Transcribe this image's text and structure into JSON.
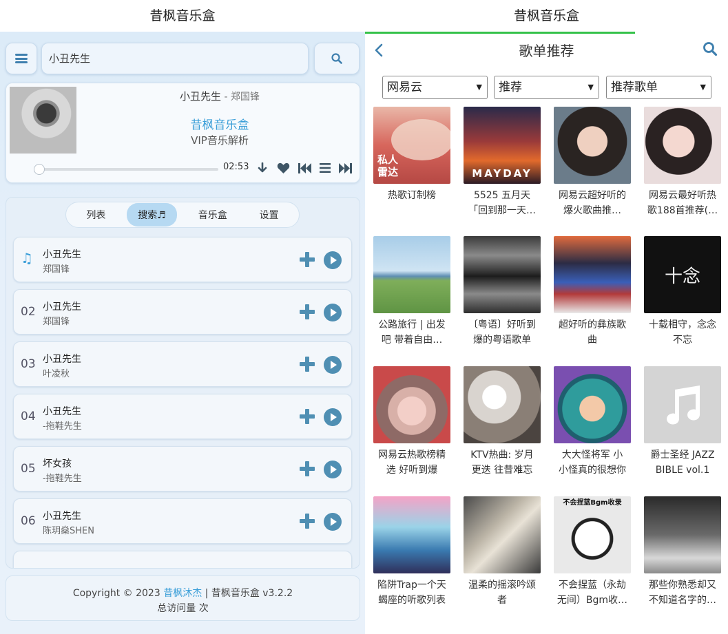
{
  "left": {
    "app_title": "昔枫音乐盒",
    "search_value": "小丑先生",
    "player": {
      "song": "小丑先生",
      "separator": " - ",
      "artist": "郑国锋",
      "brand": "昔枫音乐盒",
      "subbrand": "VIP音乐解析",
      "time": "02:53",
      "progress": 0
    },
    "tabs": [
      "列表",
      "搜索♬",
      "音乐盒",
      "设置"
    ],
    "rows": [
      {
        "index": "♫",
        "title": "小丑先生",
        "artist": "郑国锋"
      },
      {
        "index": "02",
        "title": "小丑先生",
        "artist": "郑国锋"
      },
      {
        "index": "03",
        "title": "小丑先生",
        "artist": "叶凌秋"
      },
      {
        "index": "04",
        "title": "小丑先生",
        "artist": "-拖鞋先生"
      },
      {
        "index": "05",
        "title": "坏女孩",
        "artist": "-拖鞋先生"
      },
      {
        "index": "06",
        "title": "小丑先生",
        "artist": "陈玥燊SHEN"
      }
    ],
    "footer": {
      "copyright": "Copyright © 2023 ",
      "author": "昔枫沐杰",
      "rest": " | 昔枫音乐盒 v3.2.2",
      "visits": "总访问量 次"
    }
  },
  "right": {
    "app_title": "昔枫音乐盒",
    "page_title": "歌单推荐",
    "selects": [
      "网易云",
      "推荐",
      "推荐歌单"
    ],
    "playlists": [
      {
        "line1": "热歌订制榜",
        "line2": "",
        "cover_text": "私人雷达"
      },
      {
        "line1": "5525 五月天",
        "line2": "「回到那一天…",
        "cover_text": "MAYDAY"
      },
      {
        "line1": "网易云超好听的",
        "line2": "爆火歌曲推…",
        "cover_text": ""
      },
      {
        "line1": "网易云最好听热",
        "line2": "歌188首推荐(…",
        "cover_text": ""
      },
      {
        "line1": "公路旅行 | 出发",
        "line2": "吧 带着自由…",
        "cover_text": ""
      },
      {
        "line1": "〔粤语〕好听到",
        "line2": "爆的粤语歌单",
        "cover_text": ""
      },
      {
        "line1": "超好听的彝族歌",
        "line2": "曲",
        "cover_text": ""
      },
      {
        "line1": "十载相守，念念",
        "line2": "不忘",
        "cover_text": "十念"
      },
      {
        "line1": "网易云热歌榜精",
        "line2": "选 好听到爆",
        "cover_text": ""
      },
      {
        "line1": "KTV热曲: 岁月",
        "line2": "更迭 往昔难忘",
        "cover_text": ""
      },
      {
        "line1": "大大怪将军 小",
        "line2": "小怪真的很想你",
        "cover_text": ""
      },
      {
        "line1": "爵士圣经 JAZZ",
        "line2": "BIBLE vol.1",
        "cover_text": ""
      },
      {
        "line1": "陷阱Trap一个天",
        "line2": "蝎座的听歌列表",
        "cover_text": ""
      },
      {
        "line1": "温柔的摇滚吟颂",
        "line2": "者",
        "cover_text": ""
      },
      {
        "line1": "不会捏蓝（永劫",
        "line2": "无间）Bgm收…",
        "cover_text": "不会捏蓝Bgm收录"
      },
      {
        "line1": "那些你熟悉却又",
        "line2": "不知道名字的…",
        "cover_text": ""
      }
    ]
  },
  "colors": {
    "accent": "#3a9ed8",
    "icon": "#3e7fae",
    "loadbar": "#35c24a"
  }
}
